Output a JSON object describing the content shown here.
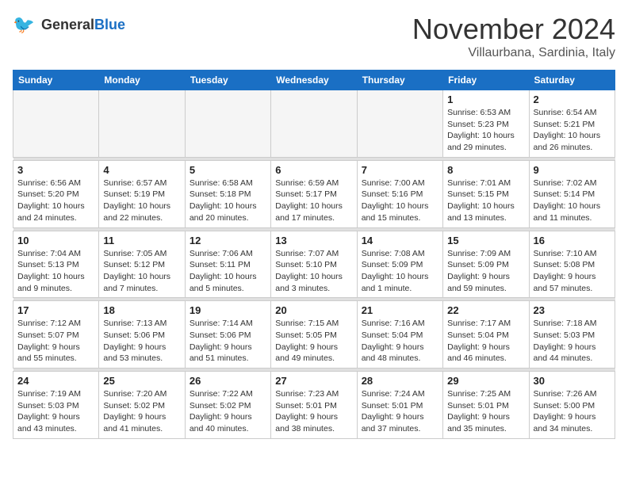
{
  "header": {
    "logo_line1": "General",
    "logo_line2": "Blue",
    "month": "November 2024",
    "location": "Villaurbana, Sardinia, Italy"
  },
  "weekdays": [
    "Sunday",
    "Monday",
    "Tuesday",
    "Wednesday",
    "Thursday",
    "Friday",
    "Saturday"
  ],
  "weeks": [
    [
      {
        "day": "",
        "info": ""
      },
      {
        "day": "",
        "info": ""
      },
      {
        "day": "",
        "info": ""
      },
      {
        "day": "",
        "info": ""
      },
      {
        "day": "",
        "info": ""
      },
      {
        "day": "1",
        "info": "Sunrise: 6:53 AM\nSunset: 5:23 PM\nDaylight: 10 hours and 29 minutes."
      },
      {
        "day": "2",
        "info": "Sunrise: 6:54 AM\nSunset: 5:21 PM\nDaylight: 10 hours and 26 minutes."
      }
    ],
    [
      {
        "day": "3",
        "info": "Sunrise: 6:56 AM\nSunset: 5:20 PM\nDaylight: 10 hours and 24 minutes."
      },
      {
        "day": "4",
        "info": "Sunrise: 6:57 AM\nSunset: 5:19 PM\nDaylight: 10 hours and 22 minutes."
      },
      {
        "day": "5",
        "info": "Sunrise: 6:58 AM\nSunset: 5:18 PM\nDaylight: 10 hours and 20 minutes."
      },
      {
        "day": "6",
        "info": "Sunrise: 6:59 AM\nSunset: 5:17 PM\nDaylight: 10 hours and 17 minutes."
      },
      {
        "day": "7",
        "info": "Sunrise: 7:00 AM\nSunset: 5:16 PM\nDaylight: 10 hours and 15 minutes."
      },
      {
        "day": "8",
        "info": "Sunrise: 7:01 AM\nSunset: 5:15 PM\nDaylight: 10 hours and 13 minutes."
      },
      {
        "day": "9",
        "info": "Sunrise: 7:02 AM\nSunset: 5:14 PM\nDaylight: 10 hours and 11 minutes."
      }
    ],
    [
      {
        "day": "10",
        "info": "Sunrise: 7:04 AM\nSunset: 5:13 PM\nDaylight: 10 hours and 9 minutes."
      },
      {
        "day": "11",
        "info": "Sunrise: 7:05 AM\nSunset: 5:12 PM\nDaylight: 10 hours and 7 minutes."
      },
      {
        "day": "12",
        "info": "Sunrise: 7:06 AM\nSunset: 5:11 PM\nDaylight: 10 hours and 5 minutes."
      },
      {
        "day": "13",
        "info": "Sunrise: 7:07 AM\nSunset: 5:10 PM\nDaylight: 10 hours and 3 minutes."
      },
      {
        "day": "14",
        "info": "Sunrise: 7:08 AM\nSunset: 5:09 PM\nDaylight: 10 hours and 1 minute."
      },
      {
        "day": "15",
        "info": "Sunrise: 7:09 AM\nSunset: 5:09 PM\nDaylight: 9 hours and 59 minutes."
      },
      {
        "day": "16",
        "info": "Sunrise: 7:10 AM\nSunset: 5:08 PM\nDaylight: 9 hours and 57 minutes."
      }
    ],
    [
      {
        "day": "17",
        "info": "Sunrise: 7:12 AM\nSunset: 5:07 PM\nDaylight: 9 hours and 55 minutes."
      },
      {
        "day": "18",
        "info": "Sunrise: 7:13 AM\nSunset: 5:06 PM\nDaylight: 9 hours and 53 minutes."
      },
      {
        "day": "19",
        "info": "Sunrise: 7:14 AM\nSunset: 5:06 PM\nDaylight: 9 hours and 51 minutes."
      },
      {
        "day": "20",
        "info": "Sunrise: 7:15 AM\nSunset: 5:05 PM\nDaylight: 9 hours and 49 minutes."
      },
      {
        "day": "21",
        "info": "Sunrise: 7:16 AM\nSunset: 5:04 PM\nDaylight: 9 hours and 48 minutes."
      },
      {
        "day": "22",
        "info": "Sunrise: 7:17 AM\nSunset: 5:04 PM\nDaylight: 9 hours and 46 minutes."
      },
      {
        "day": "23",
        "info": "Sunrise: 7:18 AM\nSunset: 5:03 PM\nDaylight: 9 hours and 44 minutes."
      }
    ],
    [
      {
        "day": "24",
        "info": "Sunrise: 7:19 AM\nSunset: 5:03 PM\nDaylight: 9 hours and 43 minutes."
      },
      {
        "day": "25",
        "info": "Sunrise: 7:20 AM\nSunset: 5:02 PM\nDaylight: 9 hours and 41 minutes."
      },
      {
        "day": "26",
        "info": "Sunrise: 7:22 AM\nSunset: 5:02 PM\nDaylight: 9 hours and 40 minutes."
      },
      {
        "day": "27",
        "info": "Sunrise: 7:23 AM\nSunset: 5:01 PM\nDaylight: 9 hours and 38 minutes."
      },
      {
        "day": "28",
        "info": "Sunrise: 7:24 AM\nSunset: 5:01 PM\nDaylight: 9 hours and 37 minutes."
      },
      {
        "day": "29",
        "info": "Sunrise: 7:25 AM\nSunset: 5:01 PM\nDaylight: 9 hours and 35 minutes."
      },
      {
        "day": "30",
        "info": "Sunrise: 7:26 AM\nSunset: 5:00 PM\nDaylight: 9 hours and 34 minutes."
      }
    ]
  ]
}
